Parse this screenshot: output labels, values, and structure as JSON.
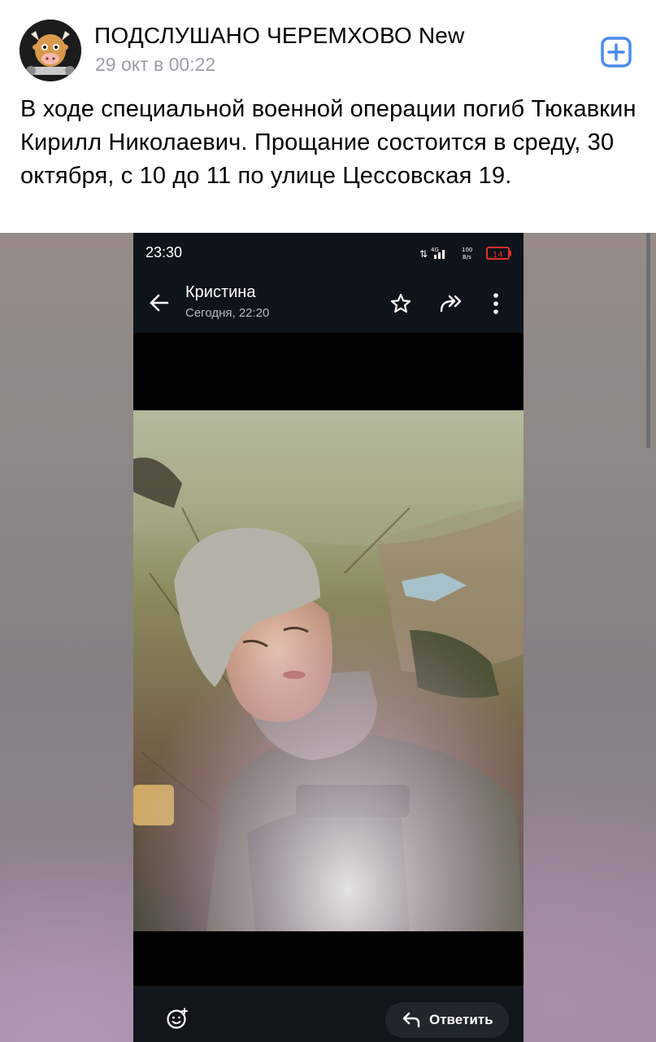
{
  "post": {
    "community_name": "ПОДСЛУШАНО ЧЕРЕМХОВО New",
    "time": "29 окт в 00:22",
    "text": "В ходе специальной военной операции погиб Тюкавкин Кирилл Николаевич. Прощание состоится в среду, 30 октября, с 10 до 11 по улице Цессовская 19."
  },
  "phone": {
    "status_time": "23:30",
    "network": "4G",
    "speed_top": "100",
    "speed_unit": "B/s",
    "battery": "14",
    "contact_name": "Кристина",
    "message_time": "Сегодня, 22:20",
    "reply_label": "Ответить"
  },
  "icons": {
    "subscribe": "plus-square-icon",
    "back": "arrow-left-icon",
    "star": "star-outline-icon",
    "forward": "forward-all-icon",
    "more": "vertical-dots-icon",
    "sticker": "emoji-add-icon",
    "reply": "reply-arrow-icon"
  },
  "colors": {
    "accent": "#4a8bf0",
    "time_gray": "#9a9fa6",
    "battery_red": "#e0302a"
  }
}
